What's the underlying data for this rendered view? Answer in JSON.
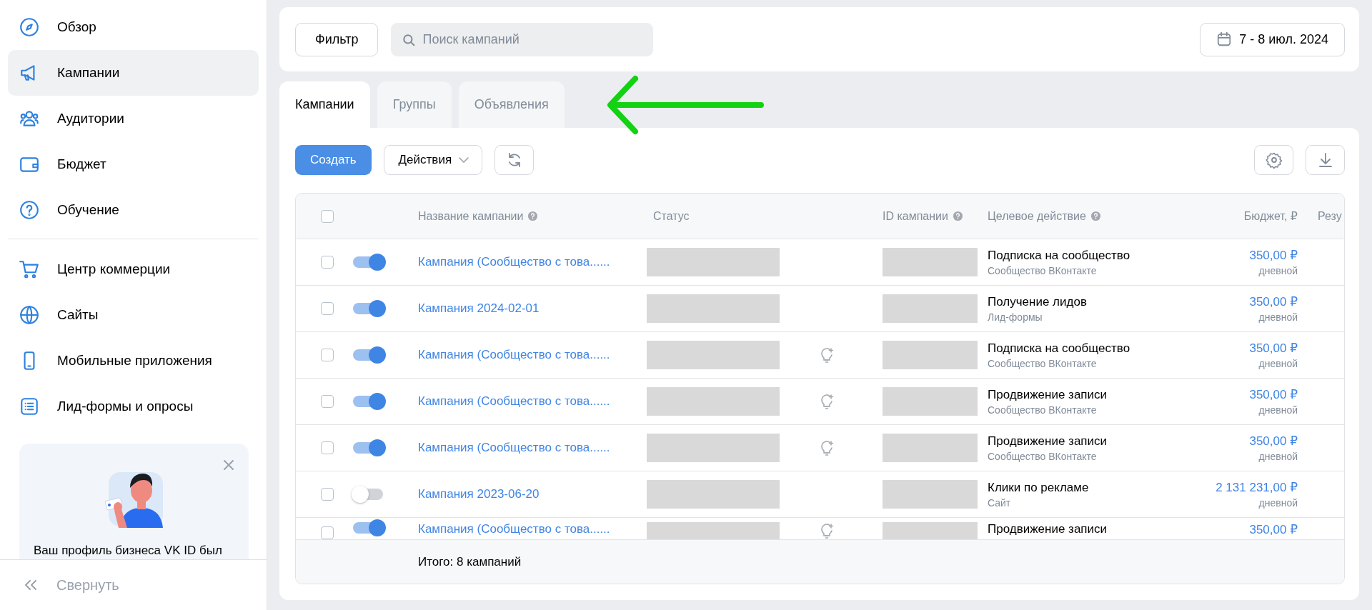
{
  "sidebar": {
    "items": [
      {
        "label": "Обзор",
        "selected": false
      },
      {
        "label": "Кампании",
        "selected": true
      },
      {
        "label": "Аудитории",
        "selected": false
      },
      {
        "label": "Бюджет",
        "selected": false
      },
      {
        "label": "Обучение",
        "selected": false
      }
    ],
    "secondary_items": [
      {
        "label": "Центр коммерции",
        "selected": false
      },
      {
        "label": "Сайты",
        "selected": false
      },
      {
        "label": "Мобильные приложения",
        "selected": false
      },
      {
        "label": "Лид-формы и опросы",
        "selected": false
      }
    ],
    "promo": {
      "text": "Ваш профиль бизнеса VK ID был"
    },
    "collapse": "Свернуть"
  },
  "filter_bar": {
    "filter_button": "Фильтр",
    "search": {
      "placeholder": "Поиск кампаний"
    },
    "date_range": "7 - 8 июл. 2024"
  },
  "tabs": [
    {
      "label": "Кампании",
      "selected": true
    },
    {
      "label": "Группы",
      "selected": false
    },
    {
      "label": "Объявления",
      "selected": false
    }
  ],
  "toolbar": {
    "create": "Создать",
    "actions": "Действия"
  },
  "table": {
    "header_checked": false,
    "columns": [
      {
        "label": "Название кампании",
        "help": true
      },
      {
        "label": "Статус",
        "help": false
      },
      {
        "label": "ID кампании",
        "help": true
      },
      {
        "label": "Целевое действие",
        "help": true
      },
      {
        "label": "Бюджет, ₽",
        "help": false
      },
      {
        "label": "Резу",
        "help": false
      }
    ],
    "rows": [
      {
        "checked": false,
        "on": true,
        "name": "Кампания (Сообщество с това......",
        "hint_icon": false,
        "target": "Подписка на сообщество",
        "target_sub": "Сообщество ВКонтакте",
        "budget": "350,00 ₽",
        "budget_period": "дневной"
      },
      {
        "checked": false,
        "on": true,
        "name": "Кампания 2024-02-01",
        "hint_icon": false,
        "target": "Получение лидов",
        "target_sub": "Лид-формы",
        "budget": "350,00 ₽",
        "budget_period": "дневной"
      },
      {
        "checked": false,
        "on": true,
        "name": "Кампания (Сообщество с това......",
        "hint_icon": true,
        "target": "Подписка на сообщество",
        "target_sub": "Сообщество ВКонтакте",
        "budget": "350,00 ₽",
        "budget_period": "дневной"
      },
      {
        "checked": false,
        "on": true,
        "name": "Кампания (Сообщество с това......",
        "hint_icon": true,
        "target": "Продвижение записи",
        "target_sub": "Сообщество ВКонтакте",
        "budget": "350,00 ₽",
        "budget_period": "дневной"
      },
      {
        "checked": false,
        "on": true,
        "name": "Кампания (Сообщество с това......",
        "hint_icon": true,
        "target": "Продвижение записи",
        "target_sub": "Сообщество ВКонтакте",
        "budget": "350,00 ₽",
        "budget_period": "дневной"
      },
      {
        "checked": false,
        "on": false,
        "name": "Кампания 2023-06-20",
        "hint_icon": false,
        "target": "Клики по рекламе",
        "target_sub": "Сайт",
        "budget": "2 131 231,00 ₽",
        "budget_period": "дневной"
      },
      {
        "checked": false,
        "on": true,
        "name": "Кампания (Сообщество с това......",
        "hint_icon": true,
        "target": "Продвижение записи",
        "budget": "350,00 ₽"
      }
    ],
    "footer": "Итого: 8 кампаний"
  }
}
